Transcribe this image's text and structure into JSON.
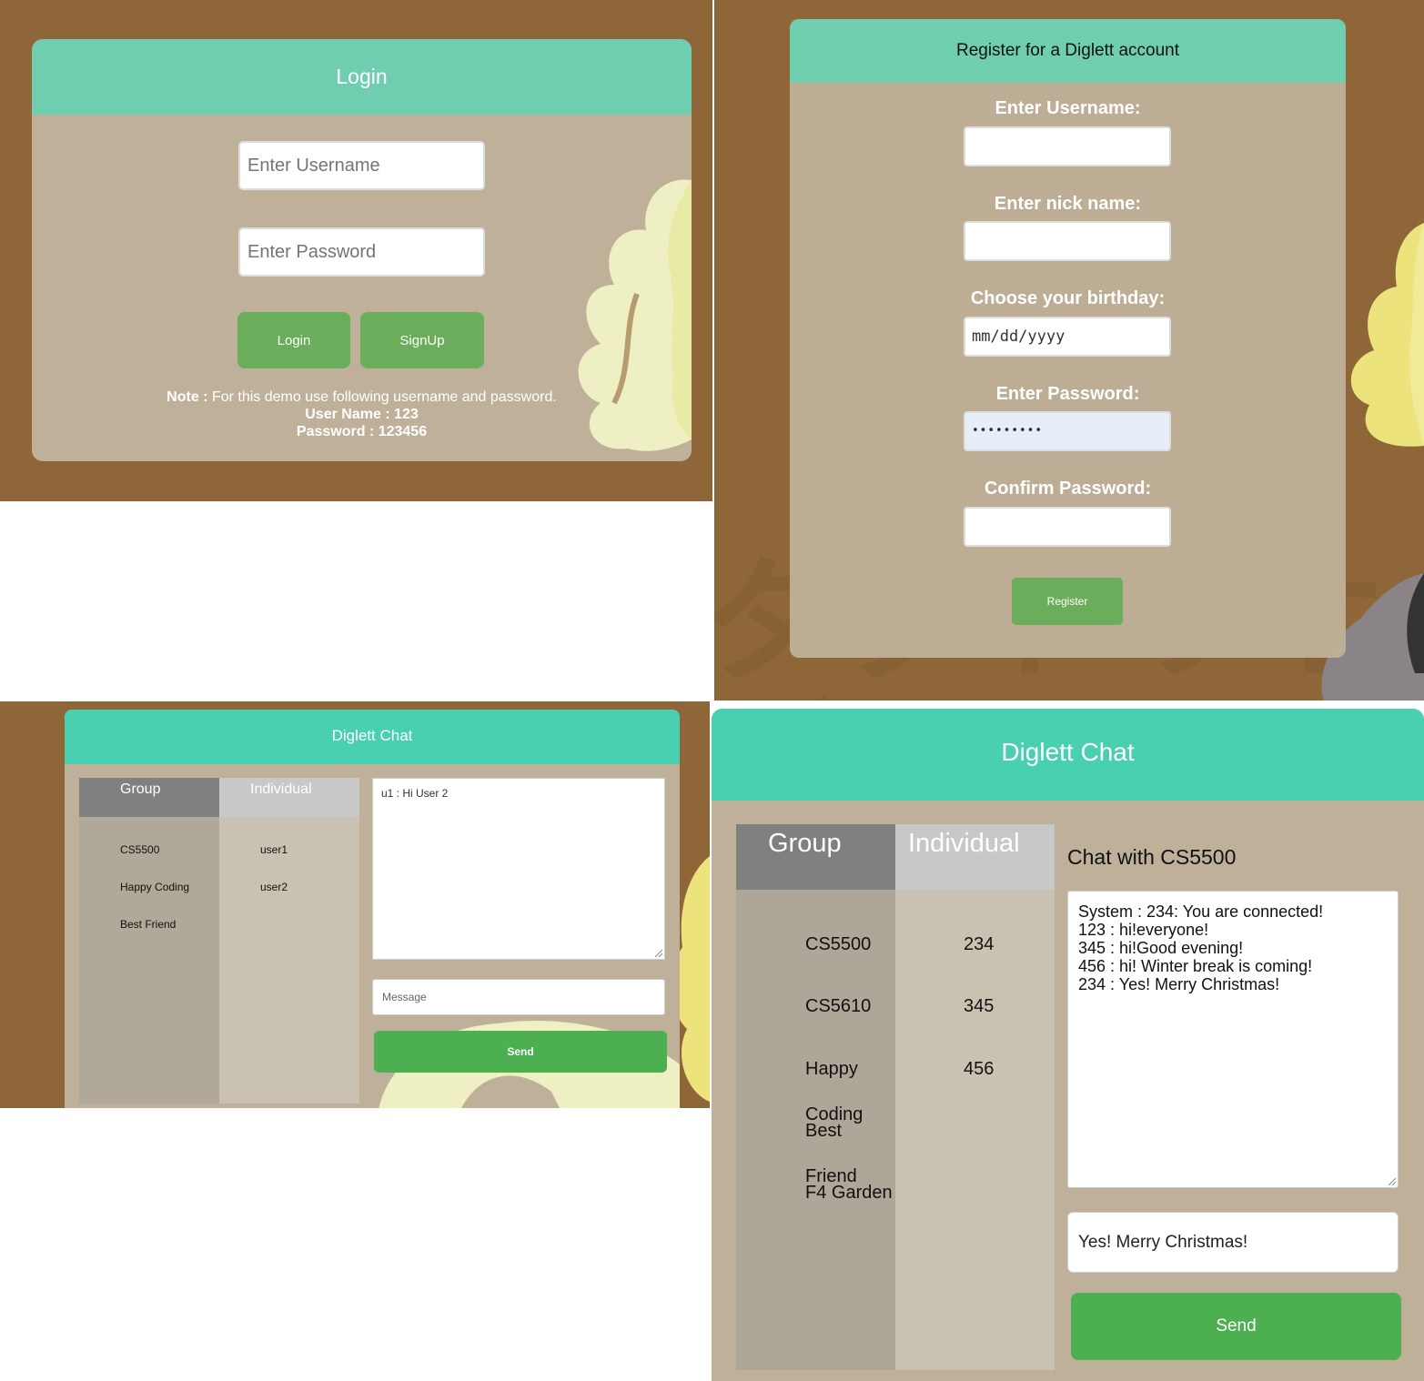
{
  "login": {
    "title": "Login",
    "username_placeholder": "Enter Username",
    "password_placeholder": "Enter Password",
    "login_button": "Login",
    "signup_button": "SignUp",
    "note_label": "Note :",
    "note_text": " For this demo use following username and password.",
    "username_line": "User Name : 123",
    "password_line": "Password : 123456"
  },
  "register": {
    "title": "Register for a Diglett account",
    "username_label": "Enter Username:",
    "nickname_label": "Enter nick name:",
    "birthday_label": "Choose your birthday:",
    "birthday_placeholder": "mm/dd/yyyy",
    "password_label": "Enter Password:",
    "password_value": "•••••••••",
    "confirm_label": "Confirm Password:",
    "register_button": "Register",
    "background_text_1": "ダグトリオ",
    "background_text_2": "グローニのすがた"
  },
  "chat_small": {
    "title": "Diglett Chat",
    "tab_group": "Group",
    "tab_individual": "Individual",
    "groups": [
      "CS5500",
      "Happy Coding",
      "Best Friend"
    ],
    "users": [
      "user1",
      "user2"
    ],
    "log": "u1 : Hi User 2",
    "message_placeholder": "Message",
    "send_button": "Send"
  },
  "chat_large": {
    "title": "Diglett Chat",
    "tab_group": "Group",
    "tab_individual": "Individual",
    "groups": [
      "CS5500",
      "CS5610",
      "Happy",
      "Coding",
      "Best",
      "Friend",
      "F4 Garden"
    ],
    "users": [
      "234",
      "345",
      "456"
    ],
    "chat_with": "Chat with CS5500",
    "log_lines": [
      "System : 234: You are connected!",
      "123 : hi!everyone!",
      "345 : hi!Good evening!",
      "456 : hi! Winter break is coming!",
      "234 : Yes! Merry Christmas!"
    ],
    "message_value": "Yes! Merry Christmas!",
    "send_button": "Send"
  },
  "colors": {
    "brown_bg": "#8f6637",
    "panel": "#bfb199",
    "header_teal": "#6fcdb0",
    "header_teal_bright": "#48d0b0",
    "button_green": "#6aad5b",
    "send_green": "#4caf50",
    "tab_group": "#808080",
    "tab_individual": "#c8c8c8"
  }
}
